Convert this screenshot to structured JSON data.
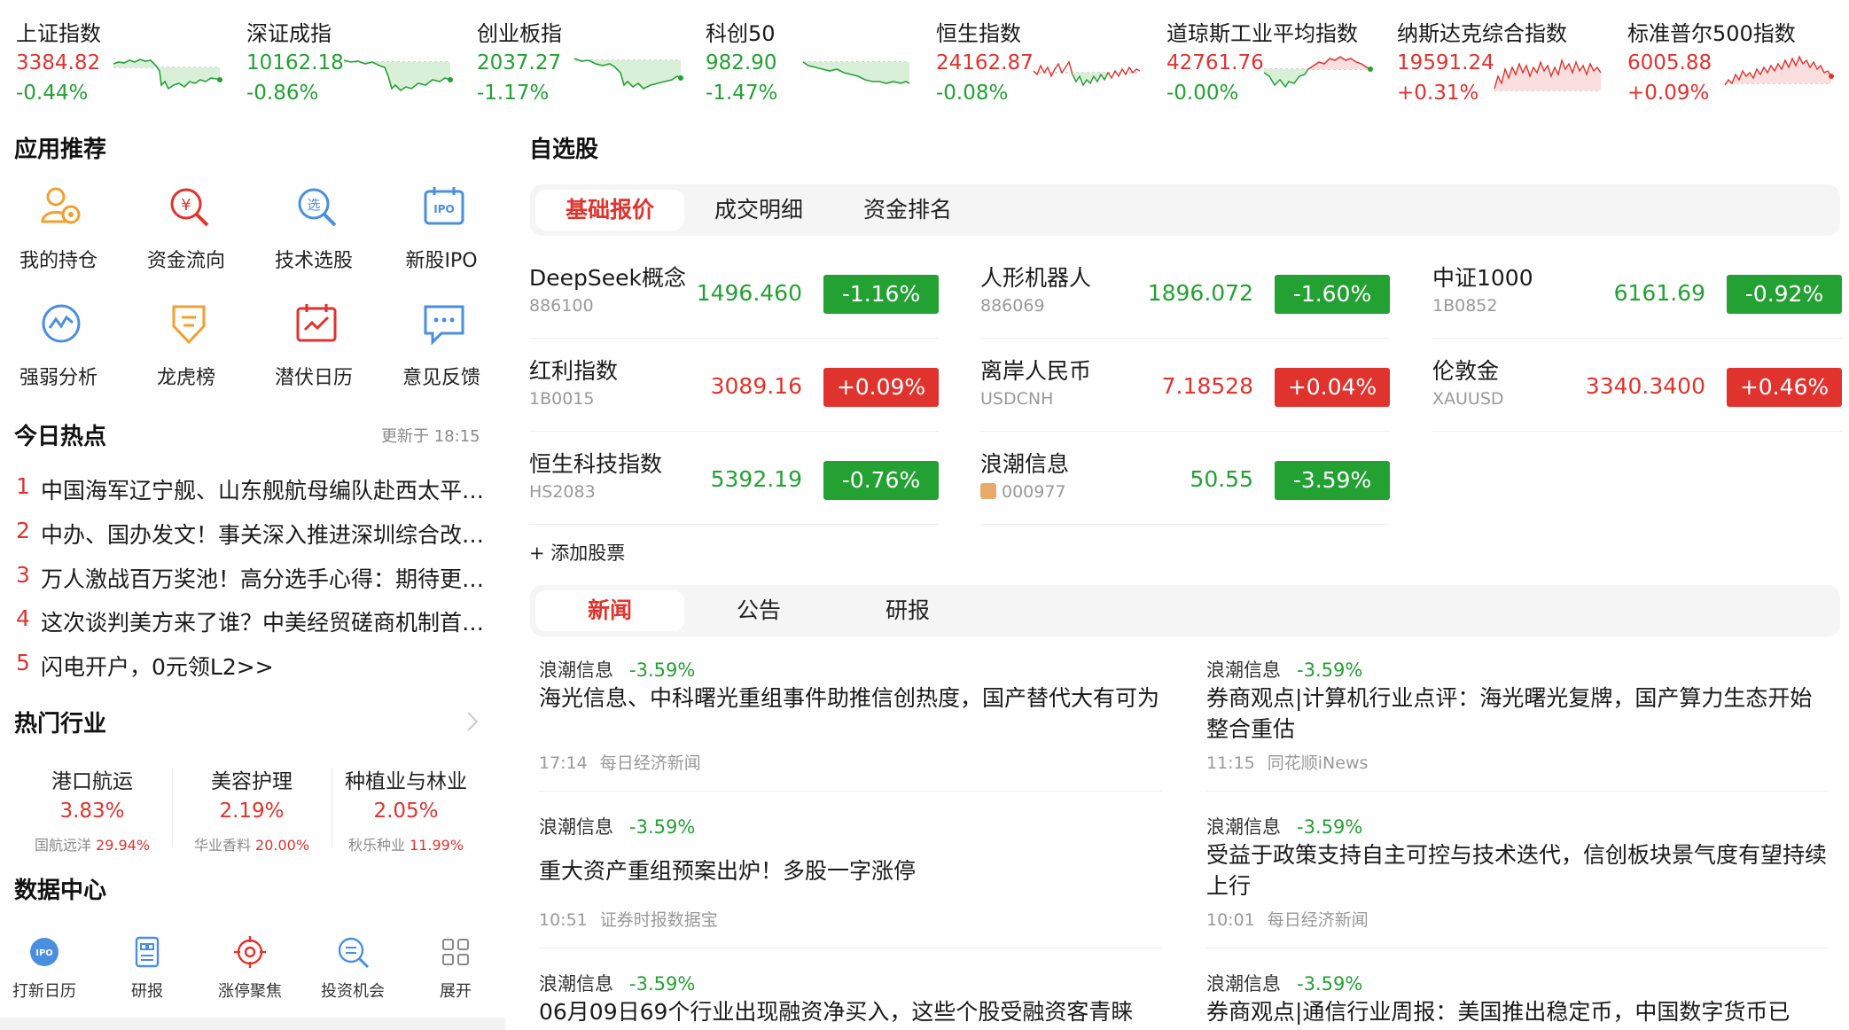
{
  "indices": [
    {
      "name": "上证指数",
      "value": "3384.82",
      "change": "-0.44%",
      "dir": "down"
    },
    {
      "name": "深证成指",
      "value": "10162.18",
      "change": "-0.86%",
      "dir": "down"
    },
    {
      "name": "创业板指",
      "value": "2037.27",
      "change": "-1.17%",
      "dir": "down"
    },
    {
      "name": "科创50",
      "value": "982.90",
      "change": "-1.47%",
      "dir": "down"
    },
    {
      "name": "恒生指数",
      "value": "24162.87",
      "change": "-0.08%",
      "dir": "down"
    },
    {
      "name": "道琼斯工业平均指数",
      "value": "42761.76",
      "change": "-0.00%",
      "dir": "down"
    },
    {
      "name": "纳斯达克综合指数",
      "value": "19591.24",
      "change": "+0.31%",
      "dir": "up"
    },
    {
      "name": "标准普尔500指数",
      "value": "6005.88",
      "change": "+0.09%",
      "dir": "up"
    }
  ],
  "apps": {
    "title": "应用推荐",
    "items": [
      {
        "label": "我的持仓",
        "icon": "portfolio-icon"
      },
      {
        "label": "资金流向",
        "icon": "fund-flow-icon"
      },
      {
        "label": "技术选股",
        "icon": "stock-picker-icon"
      },
      {
        "label": "新股IPO",
        "icon": "ipo-icon",
        "badge": "IPO"
      },
      {
        "label": "强弱分析",
        "icon": "strength-analysis-icon"
      },
      {
        "label": "龙虎榜",
        "icon": "dragon-tiger-icon"
      },
      {
        "label": "潜伏日历",
        "icon": "calendar-icon"
      },
      {
        "label": "意见反馈",
        "icon": "feedback-icon"
      }
    ]
  },
  "hot": {
    "title": "今日热点",
    "updated": "更新于 18:15",
    "items": [
      {
        "num": "1",
        "text": "中国海军辽宁舰、山东舰航母编队赴西太平洋训练"
      },
      {
        "num": "2",
        "text": "中办、国办发文！事关深入推进深圳综合改革试点"
      },
      {
        "num": "3",
        "text": "万人激战百万奖池！高分选手心得：期待更多机会"
      },
      {
        "num": "4",
        "text": "这次谈判美方来了谁？中美经贸磋商机制首次会议"
      },
      {
        "num": "5",
        "text": "闪电开户，0元领L2>>"
      }
    ]
  },
  "industries": {
    "title": "热门行业",
    "items": [
      {
        "name": "港口航运",
        "pct": "3.83%",
        "leader": "国航远洋",
        "leader_pct": "29.94%"
      },
      {
        "name": "美容护理",
        "pct": "2.19%",
        "leader": "华业香料",
        "leader_pct": "20.00%"
      },
      {
        "name": "种植业与林业",
        "pct": "2.05%",
        "leader": "秋乐种业",
        "leader_pct": "11.99%"
      }
    ]
  },
  "data_center": {
    "title": "数据中心",
    "items": [
      {
        "label": "打新日历",
        "icon": "ipo-calendar-icon",
        "badge": "IPO"
      },
      {
        "label": "研报",
        "icon": "research-report-icon"
      },
      {
        "label": "涨停聚焦",
        "icon": "limit-up-focus-icon"
      },
      {
        "label": "投资机会",
        "icon": "investment-opportunity-icon"
      },
      {
        "label": "展开",
        "icon": "expand-grid-icon"
      }
    ]
  },
  "watchlist": {
    "title": "自选股",
    "tabs": [
      "基础报价",
      "成交明细",
      "资金排名"
    ],
    "active_tab": 0,
    "stocks": [
      {
        "name": "DeepSeek概念",
        "code": "886100",
        "price": "1496.460",
        "change": "-1.16%",
        "dir": "down"
      },
      {
        "name": "人形机器人",
        "code": "886069",
        "price": "1896.072",
        "change": "-1.60%",
        "dir": "down"
      },
      {
        "name": "中证1000",
        "code": "1B0852",
        "price": "6161.69",
        "change": "-0.92%",
        "dir": "down"
      },
      {
        "name": "红利指数",
        "code": "1B0015",
        "price": "3089.16",
        "change": "+0.09%",
        "dir": "up"
      },
      {
        "name": "离岸人民币",
        "code": "USDCNH",
        "price": "7.18528",
        "change": "+0.04%",
        "dir": "up"
      },
      {
        "name": "伦敦金",
        "code": "XAUUSD",
        "price": "3340.3400",
        "change": "+0.46%",
        "dir": "up"
      },
      {
        "name": "恒生科技指数",
        "code": "HS2083",
        "price": "5392.19",
        "change": "-0.76%",
        "dir": "down"
      },
      {
        "name": "浪潮信息",
        "code": "000977",
        "price": "50.55",
        "change": "-3.59%",
        "dir": "down",
        "tagged": true
      }
    ],
    "add_label": "+ 添加股票"
  },
  "news": {
    "tabs": [
      "新闻",
      "公告",
      "研报"
    ],
    "active_tab": 0,
    "items": [
      {
        "stock": "浪潮信息",
        "change": "-3.59%",
        "title": "海光信息、中科曙光重组事件助推信创热度，国产替代大有可为",
        "time": "17:14",
        "source": "每日经济新闻"
      },
      {
        "stock": "浪潮信息",
        "change": "-3.59%",
        "title": "券商观点|计算机行业点评：海光曙光复牌，国产算力生态开始整合重估",
        "time": "11:15",
        "source": "同花顺iNews"
      },
      {
        "stock": "浪潮信息",
        "change": "-3.59%",
        "title": "重大资产重组预案出炉！多股一字涨停",
        "time": "10:51",
        "source": "证券时报数据宝"
      },
      {
        "stock": "浪潮信息",
        "change": "-3.59%",
        "title": "受益于政策支持自主可控与技术迭代，信创板块景气度有望持续上行",
        "time": "10:01",
        "source": "每日经济新闻"
      },
      {
        "stock": "浪潮信息",
        "change": "-3.59%",
        "title": "06月09日69个行业出现融资净买入，这些个股受融资客青睐",
        "time": "",
        "source": ""
      },
      {
        "stock": "浪潮信息",
        "change": "-3.59%",
        "title": "券商观点|通信行业周报：美国推出稳定币，中国数字货币已",
        "time": "",
        "source": ""
      }
    ]
  },
  "colors": {
    "up": "#e0332e",
    "down": "#23a133",
    "accent": "#e0332e",
    "icon": "#4a8ee0",
    "icon_orange": "#f0a030"
  }
}
